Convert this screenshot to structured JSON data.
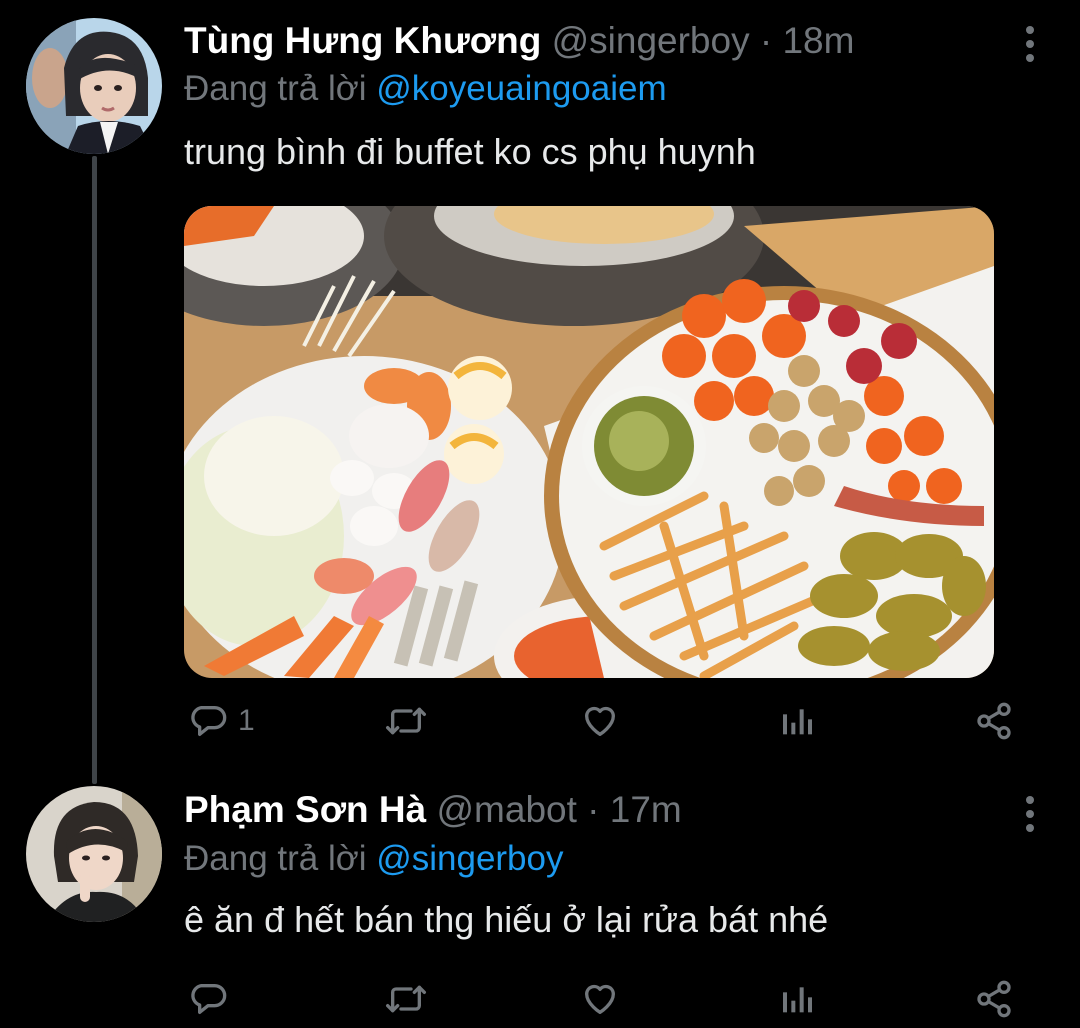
{
  "tweets": [
    {
      "name": "Tùng Hưng Khương",
      "handle": "@singerboy",
      "separator": "·",
      "time": "18m",
      "reply_prefix": "Đang trả lời",
      "reply_to": "@koyeuaingoaiem",
      "text": "trung bình đi buffet ko cs phụ huynh",
      "reply_count": "1",
      "icons": [
        "comment-icon",
        "retweet-icon",
        "like-icon",
        "analytics-icon",
        "share-icon"
      ]
    },
    {
      "name": "Phạm Sơn Hà",
      "handle": "@mabot",
      "separator": "·",
      "time": "17m",
      "reply_prefix": "Đang trả lời",
      "reply_to": "@singerboy",
      "text": "ê ăn đ hết bán thg hiếu ở lại rửa bát nhé",
      "reply_count": "",
      "icons": [
        "comment-icon",
        "retweet-icon",
        "like-icon",
        "analytics-icon",
        "share-icon"
      ]
    }
  ],
  "colors": {
    "background": "#000000",
    "secondary_text": "#71767b",
    "link": "#1d9bf0",
    "thread_line": "#3f4448"
  }
}
